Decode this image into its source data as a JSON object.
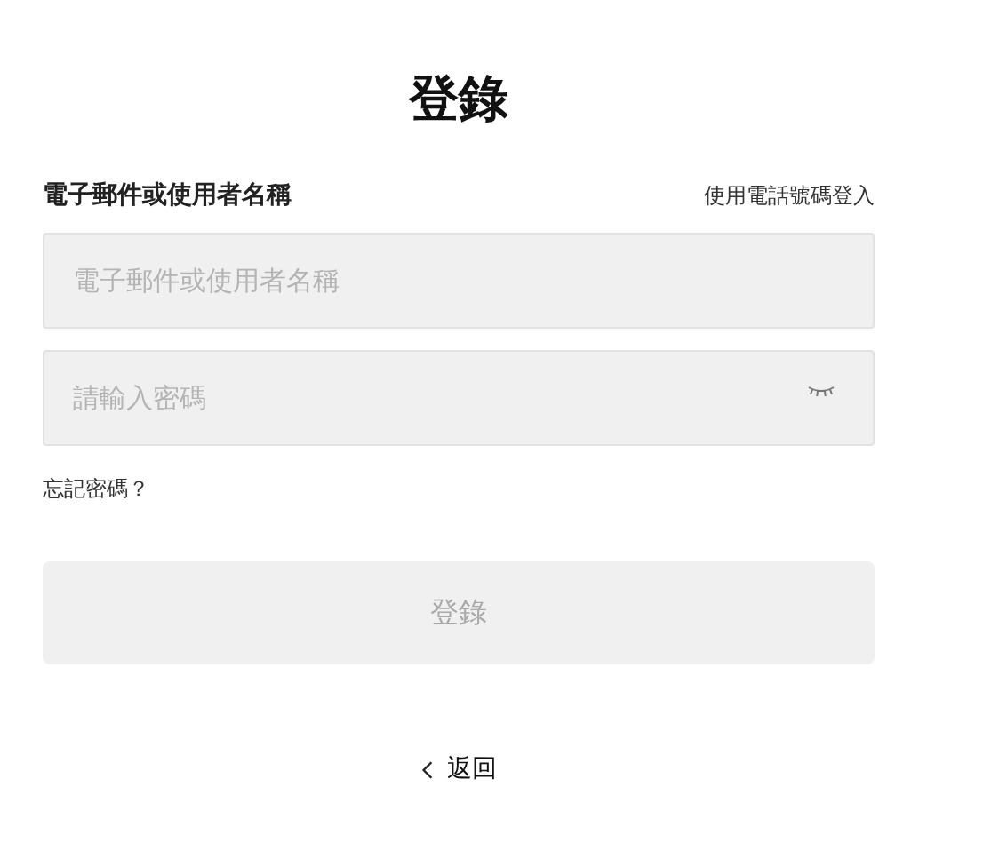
{
  "title": "登錄",
  "account_label": "電子郵件或使用者名稱",
  "phone_login_link": "使用電話號碼登入",
  "account_field": {
    "placeholder": "電子郵件或使用者名稱"
  },
  "password_field": {
    "placeholder": "請輸入密碼",
    "password_visible": false
  },
  "forgot_password_link": "忘記密碼？",
  "login_button": {
    "label": "登錄",
    "disabled": true
  },
  "back_link": "返回"
}
